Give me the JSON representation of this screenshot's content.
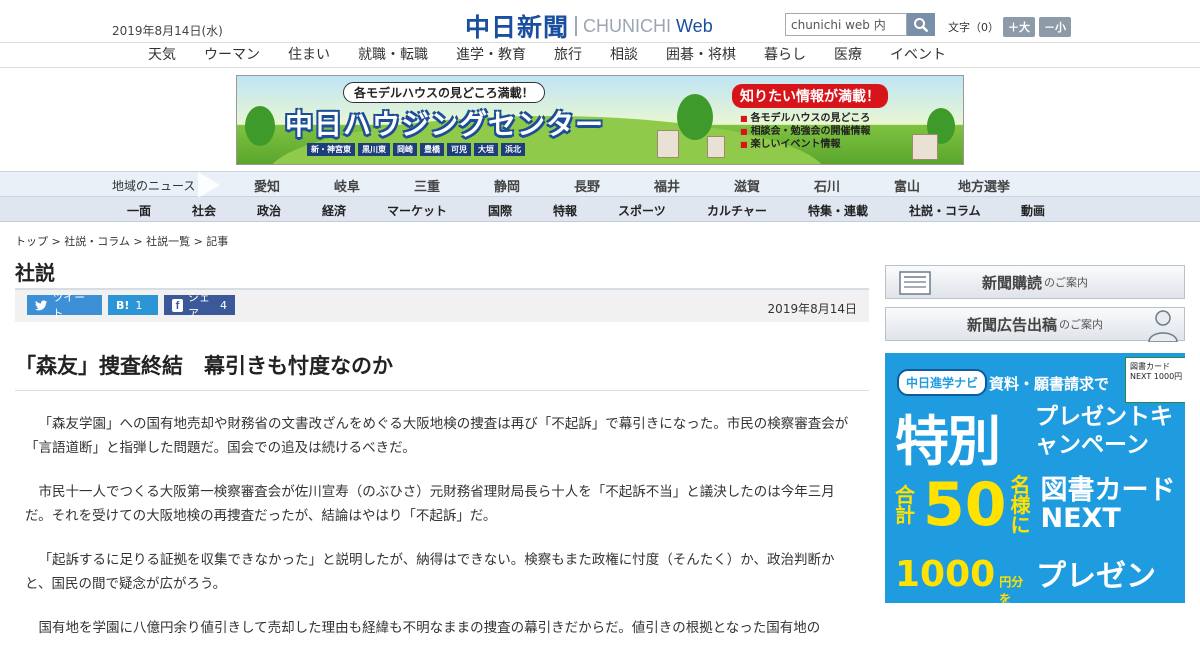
{
  "header": {
    "date": "2019年8月14日(水)",
    "logo_kanji": "中日新聞",
    "logo_en": "CHUNICHI",
    "logo_web": "Web",
    "search_value": "chunichi web 内",
    "fontsize_label": "文字（0）",
    "font_larger": "＋大",
    "font_smaller": "－小"
  },
  "subnav": [
    "天気",
    "ウーマン",
    "住まい",
    "就職・転職",
    "進学・教育",
    "旅行",
    "相談",
    "囲碁・将棋",
    "暮らし",
    "医療",
    "イベント"
  ],
  "banner": {
    "tagline": "各モデルハウスの見どころ満載！",
    "title": "中日ハウジングセンター",
    "areas": [
      "新・神宮東",
      "黒川東",
      "岡崎",
      "豊橋",
      "可児",
      "大垣",
      "浜北"
    ],
    "info_head": "知りたい情報が満載！",
    "info_items": [
      "各モデルハウスの見どころ",
      "相談会・勉強会の開催情報",
      "楽しいイベント情報"
    ]
  },
  "region_nav": {
    "label": "地域のニュース",
    "items": [
      "愛知",
      "岐阜",
      "三重",
      "静岡",
      "長野",
      "福井",
      "滋賀",
      "石川",
      "富山",
      "地方選挙"
    ]
  },
  "main_nav": [
    "一面",
    "社会",
    "政治",
    "経済",
    "マーケット",
    "国際",
    "特報",
    "スポーツ",
    "カルチャー",
    "特集・連載",
    "社説・コラム",
    "動画"
  ],
  "breadcrumb": "トップ > 社説・コラム > 社説一覧 > 記事",
  "section_title": "社説",
  "share": {
    "tweet": "ツイート",
    "hatena_label": "B!",
    "hatena_count": "1",
    "facebook_label": "シェア",
    "facebook_count": "4",
    "date": "2019年8月14日"
  },
  "article": {
    "headline": "「森友」捜査終結　幕引きも忖度なのか",
    "paragraphs": [
      "「森友学園」への国有地売却や財務省の文書改ざんをめぐる大阪地検の捜査は再び「不起訴」で幕引きになった。市民の検察審査会が「言語道断」と指弾した問題だ。国会での追及は続けるべきだ。",
      "市民十一人でつくる大阪第一検察審査会が佐川宣寿（のぶひさ）元財務省理財局長ら十人を「不起訴不当」と議決したのは今年三月だ。それを受けての大阪地検の再捜査だったが、結論はやはり「不起訴」だ。",
      "「起訴するに足りる証拠を収集できなかった」と説明したが、納得はできない。検察もまた政権に忖度（そんたく）か、政治判断かと、国民の間で疑念が広がろう。",
      "国有地を学園に八億円余り値引きして売却した理由も経緯も不明なままの捜査の幕引きだからだ。値引きの根拠となった国有地の"
    ]
  },
  "sidebar": {
    "subscribe_big": "新聞購読",
    "subscribe_small": "のご案内",
    "ad_big": "新聞広告出稿",
    "ad_small": "のご案内"
  },
  "ad": {
    "navi": "中日進学ナビ",
    "request": "資料・願書請求で",
    "card_text": "図書カードNEXT 1000円",
    "special": "特別",
    "campaign": "プレゼントキャンペーン",
    "total": "合計",
    "fifty": "50",
    "persons": "名様に",
    "card": "図書カードNEXT",
    "yen": "1000",
    "yen_unit": "円分を",
    "present": "プレゼント!"
  }
}
